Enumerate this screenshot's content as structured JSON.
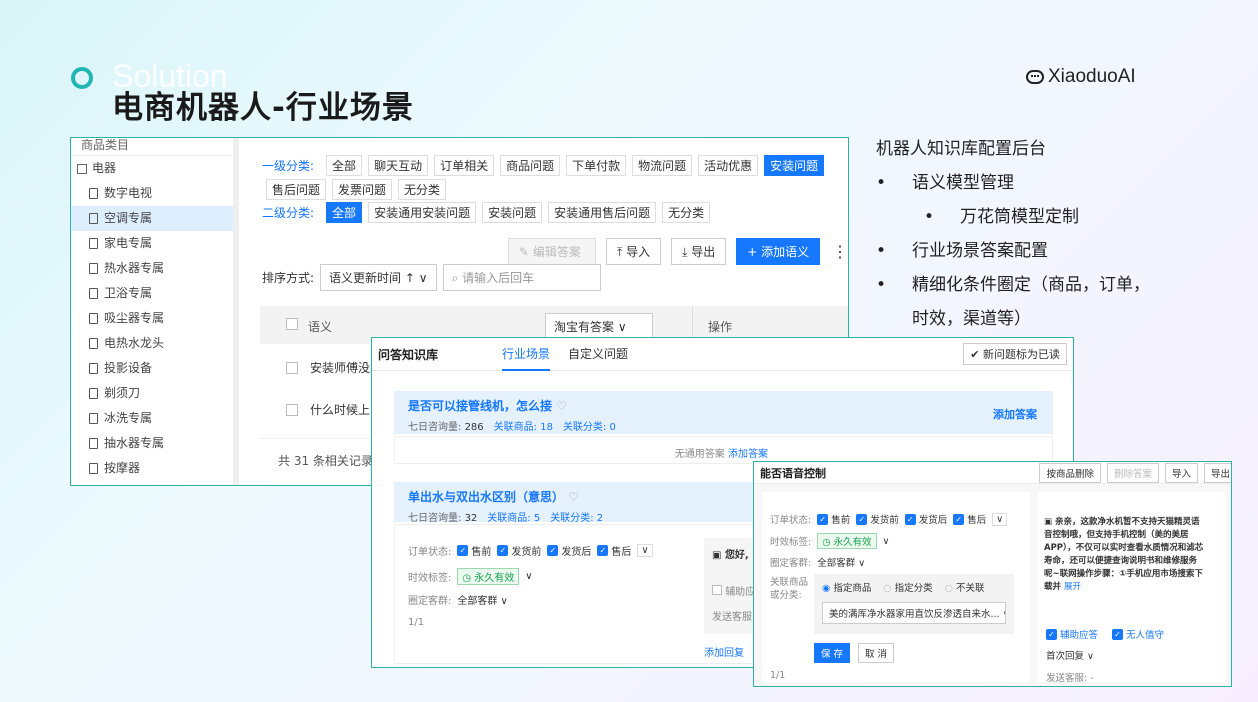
{
  "header": {
    "solution_text": "Solution",
    "title": "电商机器人-行业场景",
    "brand": "XiaoduoAI"
  },
  "notes": {
    "heading": "机器人知识库配置后台",
    "b1": "语义模型管理",
    "b1a": "万花筒模型定制",
    "b2": "行业场景答案配置",
    "b3": "精细化条件圈定（商品，订单，",
    "b3b": "时效，渠道等）"
  },
  "kb": {
    "tree": {
      "header": "商品类目",
      "root": "电器",
      "items": [
        "数字电视",
        "空调专属",
        "家电专属",
        "热水器专属",
        "卫浴专属",
        "吸尘器专属",
        "电热水龙头",
        "投影设备",
        "剃须刀",
        "冰洗专属",
        "抽水器专属",
        "按摩器"
      ],
      "selected_index": 1
    },
    "cat1_label": "一级分类:",
    "cat1": [
      "全部",
      "聊天互动",
      "订单相关",
      "商品问题",
      "下单付款",
      "物流问题",
      "活动优惠",
      "安装问题"
    ],
    "cat1_row2": [
      "售后问题",
      "发票问题",
      "无分类"
    ],
    "cat1_selected": "安装问题",
    "cat2_label": "二级分类:",
    "cat2": [
      "全部",
      "安装通用安装问题",
      "安装问题",
      "安装通用售后问题",
      "无分类"
    ],
    "edit_btn": "编辑答案",
    "import_btn": "导入",
    "export_btn": "导出",
    "add_btn": "+ 添加语义",
    "sort_label": "排序方式:",
    "sort_value": "语义更新时间 ↑",
    "search_placeholder": "请输入后回车",
    "col_semantic": "语义",
    "col_answer_select": "淘宝有答案",
    "col_op": "操作",
    "rows": [
      "安装师傅没来",
      "什么时候上门"
    ],
    "total": "共 31 条相关记录"
  },
  "qa": {
    "title": "问答知识库",
    "tab1": "行业场景",
    "tab2": "自定义问题",
    "mark_btn": "新问题标为已读",
    "q1": "是否可以接管线机，怎么接",
    "q1_count_label": "七日咨询量:",
    "q1_count": "286",
    "q1_prod": "关联商品: 18",
    "q1_cat": "关联分类: 0",
    "add_answer": "添加答案",
    "no_answer": "无通用答案",
    "add_answer_link": "添加答案",
    "q2": "单出水与双出水区别（意思）",
    "q2_count_label": "七日咨询量:",
    "q2_count": "32",
    "q2_prod": "关联商品: 5",
    "q2_cat": "关联分类: 2",
    "order_label": "订单状态:",
    "order_states": [
      "售前",
      "发货前",
      "发货后",
      "售后"
    ],
    "time_label": "时效标签:",
    "time_value": "永久有效",
    "cust_label": "圈定客群:",
    "cust_value": "全部客群 ∨",
    "page": "1/1",
    "reply_preview": "您好,",
    "assist": "辅助应",
    "send_label": "发送客服:",
    "add_reply": "添加回复"
  },
  "voice": {
    "title": "能否语音控制",
    "btn_del_prod": "按商品删除",
    "btn_del_ans": "删除答案",
    "btn_import": "导入",
    "btn_export": "导出",
    "order_label": "订单状态:",
    "order_states": [
      "售前",
      "发货前",
      "发货后",
      "售后"
    ],
    "time_label": "时效标签:",
    "time_value": "永久有效",
    "cust_label": "圈定客群:",
    "cust_value": "全部客群 ∨",
    "prod_label1": "关联商品",
    "prod_label2": "或分类:",
    "radio1": "指定商品",
    "radio2": "指定分类",
    "radio3": "不关联",
    "product": "美的满厍净水器家用直饮反渗透自来水...",
    "save": "保 存",
    "cancel": "取 消",
    "page": "1/1",
    "answer": "亲亲，这款净水机暂不支持天猫精灵语音控制哦，但支持手机控制（美的美居APP），不仅可以实时查看水质情况和滤芯寿命，还可以便捷查询说明书和维修服务呢~联网操作步骤：①手机应用市场搜索下载并",
    "expand": "展开",
    "assist": "辅助应答",
    "unmanned": "无人值守",
    "first_reply": "首次回复 ∨",
    "send": "发送客服: -"
  }
}
